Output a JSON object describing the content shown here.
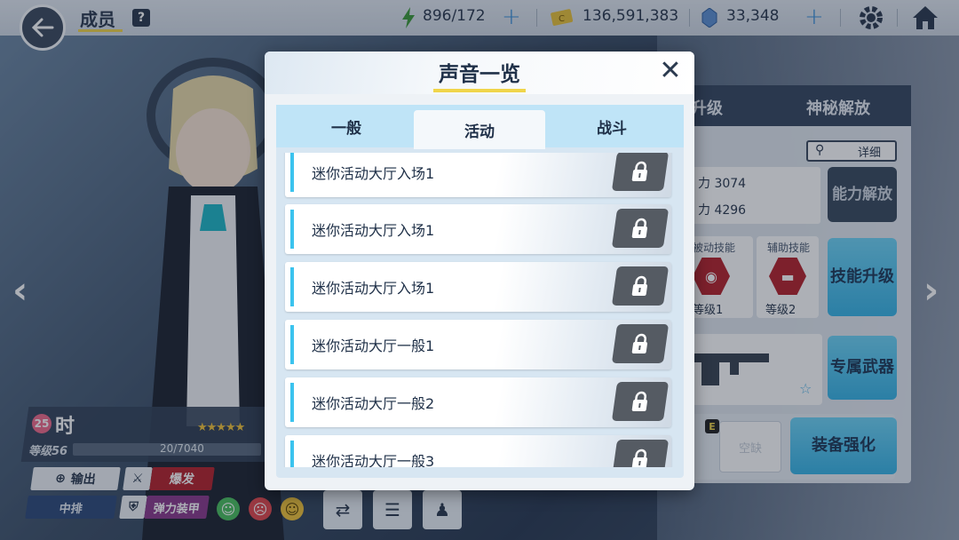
{
  "topbar": {
    "title": "成员",
    "help_label": "?",
    "ap": "896/172",
    "credits": "136,591,383",
    "gems": "33,348",
    "plus": "+"
  },
  "background_panel": {
    "tabs": [
      "升级",
      "神秘解放"
    ],
    "detail_label": "详细",
    "stat1": "力 3074",
    "stat2": "力 4296",
    "ability_release": "能力解放",
    "skill_upgrade": "技能升级",
    "passive_skill": "被动技能",
    "support_skill": "辅助技能",
    "passive_level": "等级1",
    "support_level": "等级2",
    "exclusive_weapon": "专属武器",
    "empty_slot": "空缺",
    "equipment_upgrade": "装备强化",
    "equip_tier": "E"
  },
  "character": {
    "level_badge": "25",
    "name": "时",
    "stars": "★★★★★",
    "level_label": "等级56",
    "exp": "20/7040",
    "role": "输出",
    "attack_type": "爆发",
    "position": "中排",
    "armor_type": "弹力装甲"
  },
  "modal": {
    "title": "声音一览",
    "close": "✕",
    "tabs": [
      "一般",
      "活动",
      "战斗"
    ],
    "active_tab": "活动",
    "items": [
      {
        "label": "迷你活动大厅入场1"
      },
      {
        "label": "迷你活动大厅入场1"
      },
      {
        "label": "迷你活动大厅入场1"
      },
      {
        "label": "迷你活动大厅一般1"
      },
      {
        "label": "迷你活动大厅一般2"
      },
      {
        "label": "迷你活动大厅一般3"
      }
    ]
  },
  "colors": {
    "accent_cyan": "#3bc3ee",
    "accent_yellow": "#f0d54a",
    "burst_red": "#b5232c",
    "armor_purple": "#8a3a8c",
    "dark_navy": "#2b3a4f"
  }
}
